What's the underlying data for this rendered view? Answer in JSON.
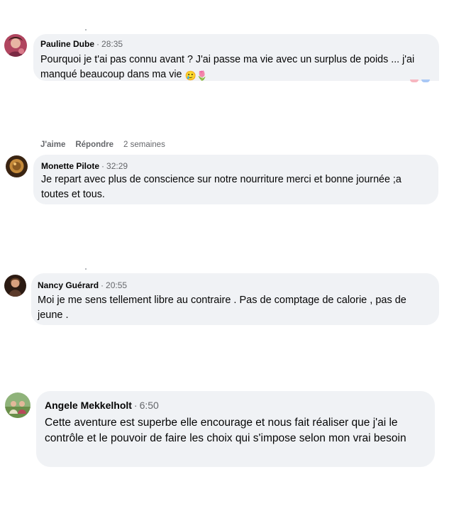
{
  "comments": [
    {
      "author": "Pauline Dube",
      "time": "28:35",
      "text": "Pourquoi je t'ai pas connu avant ? J'ai passe ma vie avec un surplus de poids ... j'ai manqué beaucoup dans ma vie",
      "emojis": [
        "🥲",
        "🌷"
      ]
    },
    {
      "author": "Monette Pilote",
      "time": "32:29",
      "text": "Je repart avec plus de conscience sur notre nourriture merci et bonne journée ;a toutes et tous."
    },
    {
      "author": "Nancy Guérard",
      "time": "20:55",
      "text": "Moi je me sens tellement libre au contraire . Pas de comptage de calorie , pas de jeune ."
    },
    {
      "author": "Angele Mekkelholt",
      "time": "6:50",
      "text": "Cette aventure est superbe elle encourage et nous fait réaliser que j'ai le contrôle et le pouvoir de faire les choix qui s'impose selon mon vrai besoin"
    }
  ],
  "actions": {
    "like": "J'aime",
    "reply": "Répondre",
    "age": "2 semaines"
  },
  "separator": "·",
  "colors": {
    "bubble": "#f0f2f5",
    "meta": "#65676b",
    "text": "#050505"
  }
}
